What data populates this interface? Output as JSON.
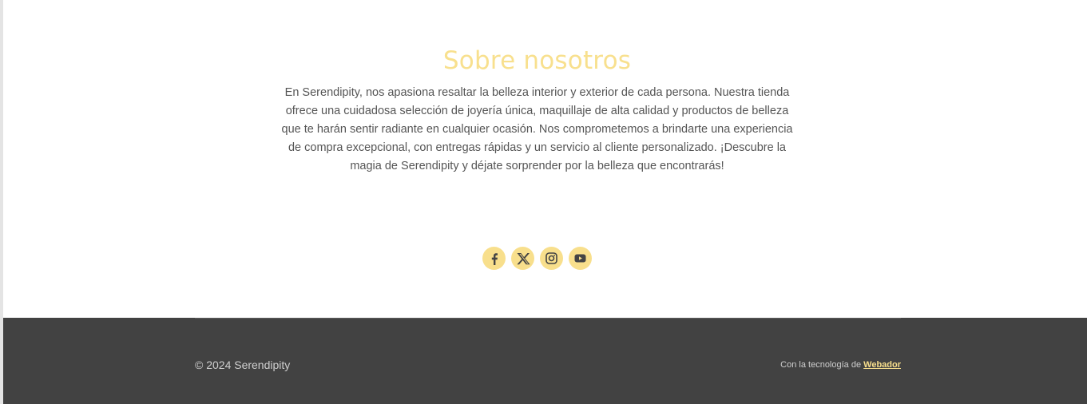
{
  "about": {
    "title": "Sobre nosotros",
    "text": "En Serendipity, nos apasiona resaltar la belleza interior y exterior de cada persona. Nuestra tienda ofrece una cuidadosa selección de joyería única, maquillaje de alta calidad y productos de belleza que te harán sentir radiante en cualquier ocasión. Nos comprometemos a brindarte una experiencia de compra excepcional, con entregas rápidas y un servicio al cliente personalizado. ¡Descubre la magia de Serendipity y déjate sorprender por la belleza que encontrarás!"
  },
  "social": {
    "icons": [
      "facebook-icon",
      "x-twitter-icon",
      "instagram-icon",
      "youtube-icon"
    ],
    "accent_color": "#f8df8c",
    "icon_color": "#444444"
  },
  "footer": {
    "copyright": "© 2024 Serendipity",
    "powered_prefix": "Con la tecnología de",
    "powered_link": "Webador",
    "background": "#424242",
    "link_color": "#f8df8c"
  },
  "colors": {
    "title": "#f8e08e",
    "body_text": "#555555"
  }
}
